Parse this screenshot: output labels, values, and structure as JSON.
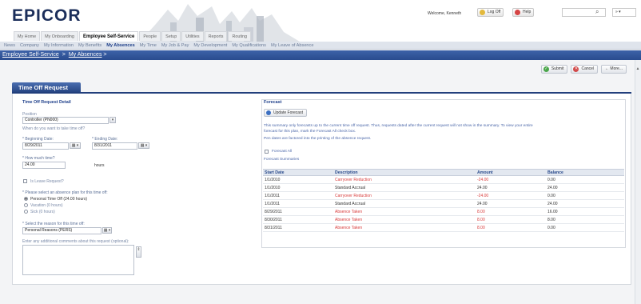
{
  "header": {
    "logo": "EPICOR",
    "welcome": "Welcome, Kenneth",
    "logoff_label": "Log Off",
    "help_label": "Help",
    "search_placeholder": "",
    "language": "» ▾"
  },
  "main_tabs": [
    {
      "label": "My Home"
    },
    {
      "label": "My Onboarding"
    },
    {
      "label": "Employee Self-Service",
      "active": true
    },
    {
      "label": "People"
    },
    {
      "label": "Setup"
    },
    {
      "label": "Utilities"
    },
    {
      "label": "Reports"
    },
    {
      "label": "Routing"
    }
  ],
  "sub_nav": [
    {
      "label": "News"
    },
    {
      "label": "Company"
    },
    {
      "label": "My Information"
    },
    {
      "label": "My Benefits"
    },
    {
      "label": "My Absences",
      "active": true
    },
    {
      "label": "My Time"
    },
    {
      "label": "My Job & Pay"
    },
    {
      "label": "My Development"
    },
    {
      "label": "My Qualifications"
    },
    {
      "label": "My Leave of Absence"
    }
  ],
  "breadcrumb": {
    "parent": "Employee Self-Service",
    "current": "My Absences",
    "sep": ">",
    "trail": ">"
  },
  "toolbar": {
    "submit_label": "Submit",
    "cancel_label": "Cancel",
    "more_label": "← More..."
  },
  "page": {
    "tab_title": "Time Off Request"
  },
  "detail": {
    "title": "Time Off Request Detail",
    "position_label": "Position",
    "position_value": "Controller (PN000)",
    "when_prompt": "When do you want to take time off?",
    "begin_label": "* Beginning Date:",
    "begin_value": "8/29/2011",
    "end_label": "* Ending Date:",
    "end_value": "8/31/2011",
    "how_much_label": "* How much time?",
    "how_much_value": "24.00",
    "hours_unit": "hours",
    "leave_label": "Is Leave Request?",
    "plan_prompt": "* Please select an absence plan for this time off:",
    "plan_options": [
      {
        "label": "Personal Time Off (24.00 hours)",
        "selected": true
      },
      {
        "label": "Vacation (0 hours)",
        "selected": false
      },
      {
        "label": "Sick (0 hours)",
        "selected": false
      }
    ],
    "reason_label": "* Select the reason for this time off:",
    "reason_value": "Personal Reasons (PERS)",
    "comments_label": "Enter any additional comments about this request (optional):",
    "calendar_icon": "▦ ▾"
  },
  "forecast": {
    "title": "Forecast",
    "update_label": "Update Forecast",
    "summary_line1": "This summary only forecasts up to the current time off request. Thus, requests dated after the current request will not show in the summary. To view your entire",
    "summary_line2": "forecast for this plan, mark the Forecast All check box.",
    "summary_line3": "Pen dates are factored into the printing of the absence request.",
    "forecast_all_label": "Forecast All",
    "summaries_label": "Forecast Summaries",
    "columns": [
      "Start Date",
      "Description",
      "Amount",
      "Balance"
    ],
    "rows": [
      {
        "date": "1/1/2010",
        "desc": "Carryover Reduction",
        "amount": "-24.00",
        "balance": "0.00",
        "red": true
      },
      {
        "date": "1/1/2010",
        "desc": "Standard Accrual",
        "amount": "24.00",
        "balance": "24.00",
        "red": false
      },
      {
        "date": "1/1/2011",
        "desc": "Carryover Reduction",
        "amount": "-24.00",
        "balance": "0.00",
        "red": true
      },
      {
        "date": "1/1/2011",
        "desc": "Standard Accrual",
        "amount": "24.00",
        "balance": "24.00",
        "red": false
      },
      {
        "date": "8/29/2011",
        "desc": "Absence Taken",
        "amount": "8.00",
        "balance": "16.00",
        "red": true
      },
      {
        "date": "8/30/2011",
        "desc": "Absence Taken",
        "amount": "8.00",
        "balance": "8.00",
        "red": true
      },
      {
        "date": "8/31/2011",
        "desc": "Absence Taken",
        "amount": "8.00",
        "balance": "0.00",
        "red": true
      }
    ]
  },
  "colors": {
    "brand_navy": "#1b2e5a",
    "nav_blue": "#2a4c8f",
    "negative_red": "#d83b3b"
  }
}
